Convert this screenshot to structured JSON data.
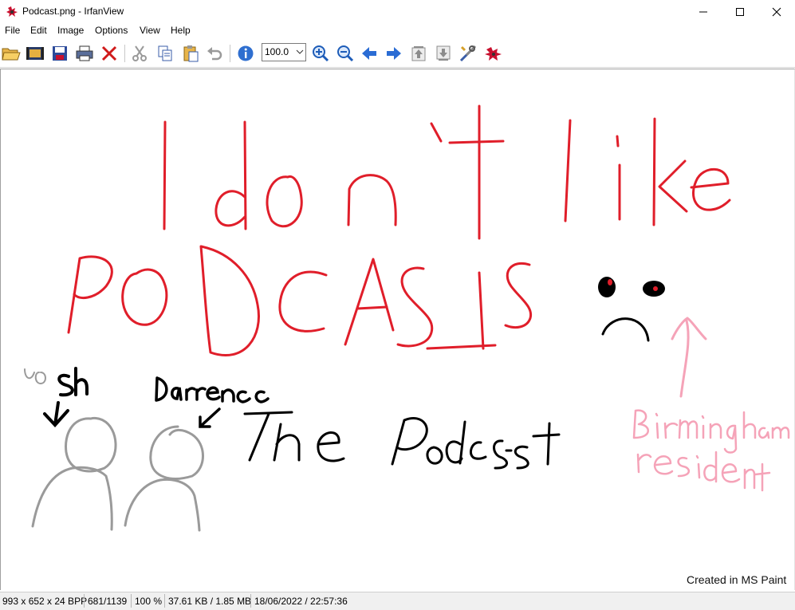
{
  "window": {
    "title": "Podcast.png - IrfanView",
    "minimize_icon": "minimize-icon",
    "maximize_icon": "maximize-icon",
    "close_icon": "close-icon"
  },
  "menu": [
    "File",
    "Edit",
    "Image",
    "Options",
    "View",
    "Help"
  ],
  "toolbar": {
    "zoom_value": "100.0",
    "icons": [
      "open-folder-icon",
      "slideshow-icon",
      "save-icon",
      "print-icon",
      "delete-icon",
      "cut-icon",
      "copy-icon",
      "paste-icon",
      "undo-icon",
      "info-icon",
      "zoom-in-icon",
      "zoom-out-icon",
      "previous-icon",
      "next-icon",
      "first-file-icon",
      "last-file-icon",
      "properties-icon",
      "exit-icon"
    ]
  },
  "image": {
    "headline_line1": "I don't like",
    "headline_line2": "PODCASTS",
    "name_josh": "Josh",
    "name_darrence": "Darrence",
    "show_title_the": "The",
    "show_title_podcast": "Podcast",
    "annotation_line1": "Birmingham",
    "annotation_line2": "resident",
    "credit": "Created in MS Paint",
    "colors": {
      "red": "#e01e2a",
      "black": "#000000",
      "gray": "#9a9a9a",
      "pink": "#f5a3b8"
    }
  },
  "status": {
    "dimensions": "993 x 652 x 24 BPP",
    "position": "681/1139",
    "zoom": "100 %",
    "size": "37.61 KB / 1.85 MB",
    "datetime": "18/06/2022 / 22:57:36"
  }
}
